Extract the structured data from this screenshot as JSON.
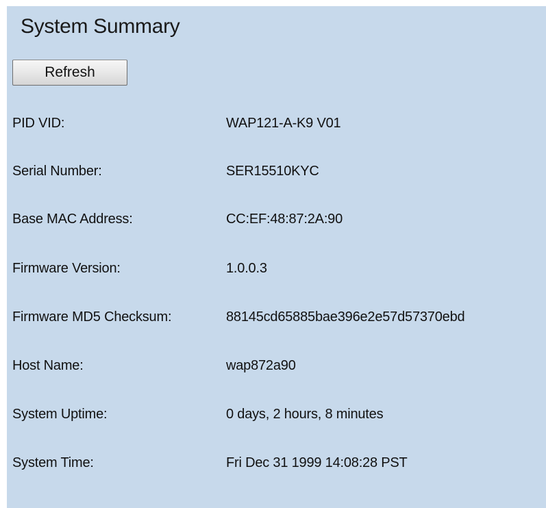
{
  "page": {
    "title": "System Summary",
    "refresh_label": "Refresh"
  },
  "summary": {
    "rows": [
      {
        "label": "PID VID:",
        "value": "WAP121-A-K9 V01"
      },
      {
        "label": "Serial Number:",
        "value": "SER15510KYC"
      },
      {
        "label": "Base MAC Address:",
        "value": "CC:EF:48:87:2A:90"
      },
      {
        "label": "Firmware Version:",
        "value": "1.0.0.3"
      },
      {
        "label": "Firmware MD5 Checksum:",
        "value": "88145cd65885bae396e2e57d57370ebd"
      },
      {
        "label": "Host Name:",
        "value": "wap872a90"
      },
      {
        "label": "System Uptime:",
        "value": "0 days, 2 hours, 8 minutes"
      },
      {
        "label": "System Time:",
        "value": "Fri Dec 31 1999 14:08:28 PST"
      }
    ]
  },
  "colors": {
    "panel_background": "#c7d9eb",
    "text": "#111111"
  }
}
